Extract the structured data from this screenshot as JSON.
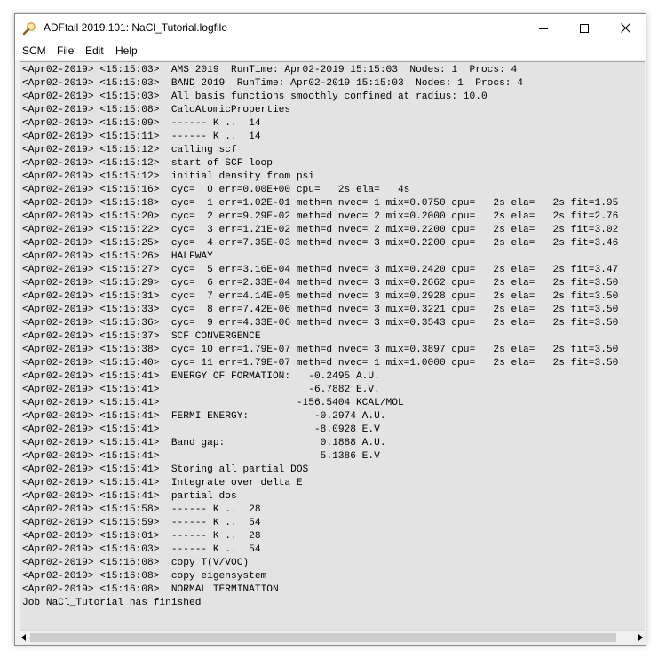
{
  "window": {
    "title": "ADFtail 2019.101: NaCl_Tutorial.logfile"
  },
  "menu": {
    "items": [
      "SCM",
      "File",
      "Edit",
      "Help"
    ]
  },
  "log": {
    "lines": [
      "<Apr02-2019> <15:15:03>  AMS 2019  RunTime: Apr02-2019 15:15:03  Nodes: 1  Procs: 4",
      "<Apr02-2019> <15:15:03>  BAND 2019  RunTime: Apr02-2019 15:15:03  Nodes: 1  Procs: 4",
      "<Apr02-2019> <15:15:03>  All basis functions smoothly confined at radius: 10.0",
      "<Apr02-2019> <15:15:08>  CalcAtomicProperties",
      "<Apr02-2019> <15:15:09>  ------ K ..  14",
      "<Apr02-2019> <15:15:11>  ------ K ..  14",
      "<Apr02-2019> <15:15:12>  calling scf",
      "<Apr02-2019> <15:15:12>  start of SCF loop",
      "<Apr02-2019> <15:15:12>  initial density from psi",
      "<Apr02-2019> <15:15:16>  cyc=  0 err=0.00E+00 cpu=   2s ela=   4s",
      "<Apr02-2019> <15:15:18>  cyc=  1 err=1.02E-01 meth=m nvec= 1 mix=0.0750 cpu=   2s ela=   2s fit=1.95",
      "<Apr02-2019> <15:15:20>  cyc=  2 err=9.29E-02 meth=d nvec= 2 mix=0.2000 cpu=   2s ela=   2s fit=2.76",
      "<Apr02-2019> <15:15:22>  cyc=  3 err=1.21E-02 meth=d nvec= 2 mix=0.2200 cpu=   2s ela=   2s fit=3.02",
      "<Apr02-2019> <15:15:25>  cyc=  4 err=7.35E-03 meth=d nvec= 3 mix=0.2200 cpu=   2s ela=   2s fit=3.46",
      "<Apr02-2019> <15:15:26>  HALFWAY",
      "<Apr02-2019> <15:15:27>  cyc=  5 err=3.16E-04 meth=d nvec= 3 mix=0.2420 cpu=   2s ela=   2s fit=3.47",
      "<Apr02-2019> <15:15:29>  cyc=  6 err=2.33E-04 meth=d nvec= 3 mix=0.2662 cpu=   2s ela=   2s fit=3.50",
      "<Apr02-2019> <15:15:31>  cyc=  7 err=4.14E-05 meth=d nvec= 3 mix=0.2928 cpu=   2s ela=   2s fit=3.50",
      "<Apr02-2019> <15:15:33>  cyc=  8 err=7.42E-06 meth=d nvec= 3 mix=0.3221 cpu=   2s ela=   2s fit=3.50",
      "<Apr02-2019> <15:15:36>  cyc=  9 err=4.33E-06 meth=d nvec= 3 mix=0.3543 cpu=   2s ela=   2s fit=3.50",
      "<Apr02-2019> <15:15:37>  SCF CONVERGENCE",
      "<Apr02-2019> <15:15:38>  cyc= 10 err=1.79E-07 meth=d nvec= 3 mix=0.3897 cpu=   2s ela=   2s fit=3.50",
      "<Apr02-2019> <15:15:40>  cyc= 11 err=1.79E-07 meth=d nvec= 1 mix=1.0000 cpu=   2s ela=   2s fit=3.50",
      "<Apr02-2019> <15:15:41>  ENERGY OF FORMATION:   -0.2495 A.U.",
      "<Apr02-2019> <15:15:41>                         -6.7882 E.V.",
      "<Apr02-2019> <15:15:41>                       -156.5404 KCAL/MOL",
      "<Apr02-2019> <15:15:41>  FERMI ENERGY:           -0.2974 A.U.",
      "<Apr02-2019> <15:15:41>                          -8.0928 E.V",
      "<Apr02-2019> <15:15:41>  Band gap:                0.1888 A.U.",
      "<Apr02-2019> <15:15:41>                           5.1386 E.V",
      "<Apr02-2019> <15:15:41>  Storing all partial DOS",
      "<Apr02-2019> <15:15:41>  Integrate over delta E",
      "<Apr02-2019> <15:15:41>  partial dos",
      "<Apr02-2019> <15:15:58>  ------ K ..  28",
      "<Apr02-2019> <15:15:59>  ------ K ..  54",
      "<Apr02-2019> <15:16:01>  ------ K ..  28",
      "<Apr02-2019> <15:16:03>  ------ K ..  54",
      "<Apr02-2019> <15:16:08>  copy T(V/VOC)",
      "<Apr02-2019> <15:16:08>  copy eigensystem",
      "<Apr02-2019> <15:16:08>  NORMAL TERMINATION",
      "Job NaCl_Tutorial has finished"
    ]
  },
  "icons": {
    "app": "magnifier-icon",
    "minimize": "minimize-icon",
    "maximize": "maximize-icon",
    "close": "close-icon",
    "scroll_left": "arrow-left-icon",
    "scroll_right": "arrow-right-icon"
  },
  "colors": {
    "log_background": "#e3e3e3",
    "titlebar": "#ffffff",
    "frame": "#f0f0f0"
  }
}
